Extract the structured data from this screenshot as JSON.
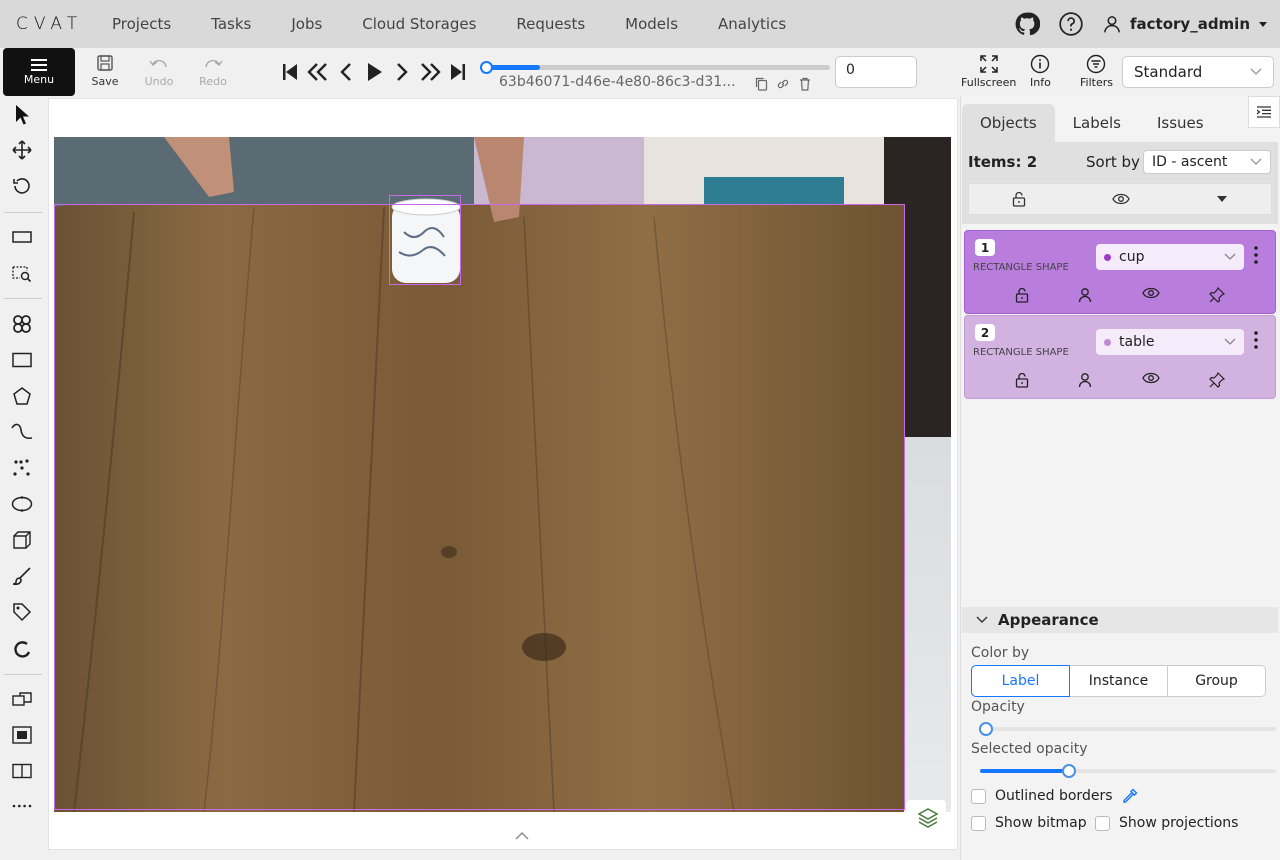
{
  "topnav": {
    "logo": "CVAT",
    "links": [
      "Projects",
      "Tasks",
      "Jobs",
      "Cloud Storages",
      "Requests",
      "Models",
      "Analytics"
    ],
    "username": "factory_admin"
  },
  "toolbar": {
    "menu_label": "Menu",
    "save_label": "Save",
    "undo_label": "Undo",
    "redo_label": "Redo",
    "job_id": "63b46071-d46e-4e80-86c3-d31...",
    "frame_value": "0",
    "frame_progress": 0.0,
    "fullscreen_label": "Fullscreen",
    "info_label": "Info",
    "filters_label": "Filters",
    "workspace_value": "Standard"
  },
  "panel": {
    "tabs": [
      "Objects",
      "Labels",
      "Issues"
    ],
    "items_count": "Items: 2",
    "sort_by_label": "Sort by",
    "sort_value": "ID - ascent",
    "objects": [
      {
        "id": "1",
        "type": "RECTANGLE SHAPE",
        "label": "cup",
        "bg": "#b97ddd",
        "label_bg": "#f5ebfa",
        "dot": "#9b39c9"
      },
      {
        "id": "2",
        "type": "RECTANGLE SHAPE",
        "label": "table",
        "bg": "#d2b2e0",
        "label_bg": "#f5ebfa",
        "dot": "#c08ad6"
      }
    ]
  },
  "appearance": {
    "title": "Appearance",
    "color_by_label": "Color by",
    "color_by_options": [
      "Label",
      "Instance",
      "Group"
    ],
    "color_by_selected": "Label",
    "opacity_label": "Opacity",
    "opacity_value": 0.02,
    "selected_opacity_label": "Selected opacity",
    "selected_opacity_value": 0.3,
    "outlined_borders_label": "Outlined borders",
    "show_bitmap_label": "Show bitmap",
    "show_projections_label": "Show projections"
  },
  "colors": {
    "accent": "#1677ff",
    "bbox": "#c86ae8"
  }
}
